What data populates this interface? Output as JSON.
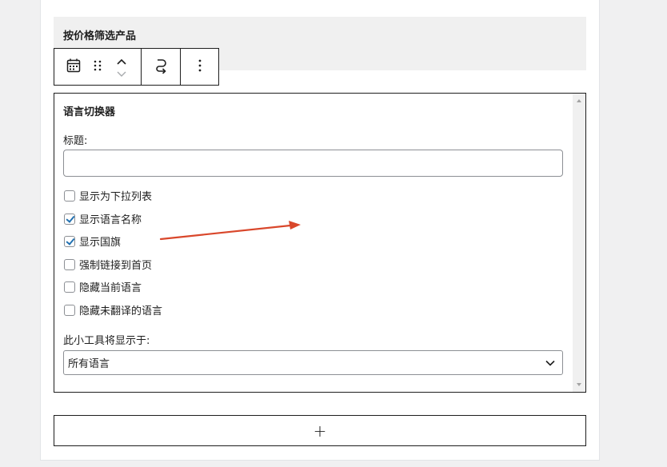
{
  "previous_block": {
    "title": "按价格筛选产品"
  },
  "toolbar": {
    "icons": [
      "calendar-icon",
      "drag-handle-icon",
      "move-up-icon",
      "move-down-icon",
      "transform-icon",
      "more-options-icon"
    ]
  },
  "widget": {
    "title": "语言切换器",
    "title_field_label": "标题:",
    "title_field_value": "",
    "options": [
      {
        "label": "显示为下拉列表",
        "checked": false
      },
      {
        "label": "显示语言名称",
        "checked": true
      },
      {
        "label": "显示国旗",
        "checked": true
      },
      {
        "label": "强制链接到首页",
        "checked": false
      },
      {
        "label": "隐藏当前语言",
        "checked": false
      },
      {
        "label": "隐藏未翻译的语言",
        "checked": false
      }
    ],
    "display_label": "此小工具将显示于:",
    "display_value": "所有语言"
  },
  "add_block": {
    "symbol": "+"
  },
  "colors": {
    "annotation_arrow": "#d9472b",
    "checkbox_check": "#2271b1"
  }
}
